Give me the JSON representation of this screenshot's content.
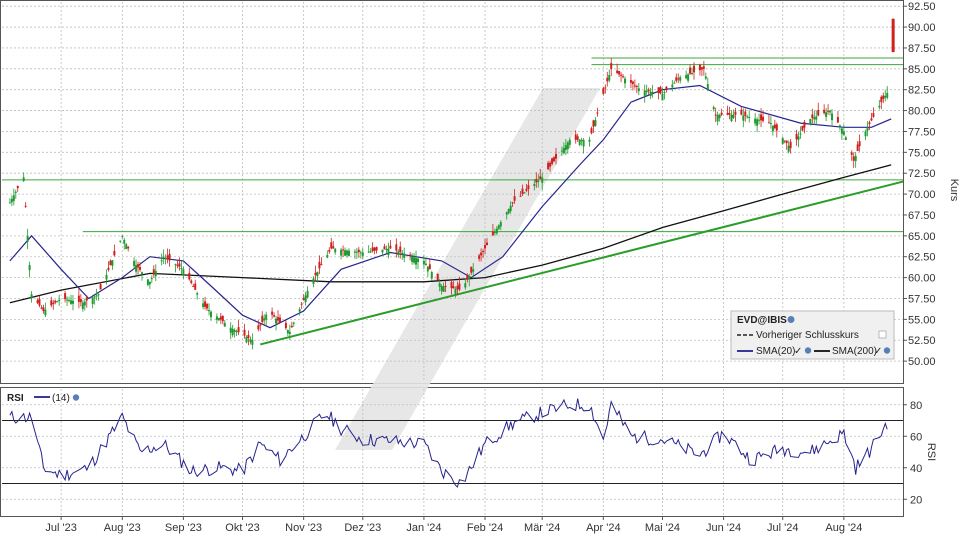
{
  "chart_data": [
    {
      "type": "candlestick",
      "legend": {
        "symbol": "EVD@IBIS",
        "prev_close_label": "Vorheriger Schlusskurs",
        "sma20_label": "SMA(20)",
        "sma200_label": "SMA(200)"
      },
      "ylabel": "Kurs",
      "ylim": [
        47.5,
        93.0
      ],
      "yticks": [
        "50.00",
        "52.50",
        "55.00",
        "57.50",
        "60.00",
        "62.50",
        "65.00",
        "67.50",
        "70.00",
        "72.50",
        "75.00",
        "77.50",
        "80.00",
        "82.50",
        "85.00",
        "87.50",
        "90.00",
        "92.50"
      ],
      "x_labels": [
        "Jul '23",
        "Aug '23",
        "Sep '23",
        "Okt '23",
        "Nov '23",
        "Dez '23",
        "Jan '24",
        "Feb '24",
        "Mär '24",
        "Apr '24",
        "Mai '24",
        "Jun '24",
        "Jul '24",
        "Aug '24"
      ],
      "price_path": [
        [
          "2023-06-05",
          69.0
        ],
        [
          "2023-06-12",
          72.0
        ],
        [
          "2023-06-16",
          58.0
        ],
        [
          "2023-06-22",
          56.0
        ],
        [
          "2023-07-01",
          57.5
        ],
        [
          "2023-07-12",
          57.0
        ],
        [
          "2023-07-20",
          58.0
        ],
        [
          "2023-08-01",
          65.0
        ],
        [
          "2023-08-08",
          61.5
        ],
        [
          "2023-08-15",
          59.5
        ],
        [
          "2023-08-22",
          62.5
        ],
        [
          "2023-09-01",
          61.0
        ],
        [
          "2023-09-12",
          56.5
        ],
        [
          "2023-09-25",
          54.0
        ],
        [
          "2023-10-06",
          52.5
        ],
        [
          "2023-10-14",
          56.0
        ],
        [
          "2023-10-25",
          53.5
        ],
        [
          "2023-11-05",
          59.5
        ],
        [
          "2023-11-15",
          63.5
        ],
        [
          "2023-12-01",
          63.0
        ],
        [
          "2023-12-15",
          63.5
        ],
        [
          "2024-01-01",
          62.0
        ],
        [
          "2024-01-10",
          59.0
        ],
        [
          "2024-01-20",
          58.5
        ],
        [
          "2024-02-01",
          63.5
        ],
        [
          "2024-02-15",
          69.0
        ],
        [
          "2024-03-01",
          72.0
        ],
        [
          "2024-03-15",
          76.5
        ],
        [
          "2024-03-25",
          76.5
        ],
        [
          "2024-04-01",
          82.0
        ],
        [
          "2024-04-05",
          85.0
        ],
        [
          "2024-04-20",
          82.5
        ],
        [
          "2024-05-01",
          82.0
        ],
        [
          "2024-05-10",
          84.0
        ],
        [
          "2024-05-22",
          85.0
        ],
        [
          "2024-05-28",
          79.5
        ],
        [
          "2024-06-10",
          79.5
        ],
        [
          "2024-06-25",
          78.5
        ],
        [
          "2024-07-05",
          75.5
        ],
        [
          "2024-07-15",
          79.0
        ],
        [
          "2024-07-25",
          80.0
        ],
        [
          "2024-08-01",
          77.5
        ],
        [
          "2024-08-06",
          74.0
        ],
        [
          "2024-08-12",
          77.5
        ],
        [
          "2024-08-20",
          81.0
        ],
        [
          "2024-08-24",
          82.5
        ]
      ],
      "last_candle": {
        "date": "2024-08-26",
        "open": 91.0,
        "close": 87.0
      },
      "sma20": [
        [
          "2023-06-05",
          62.0
        ],
        [
          "2023-06-16",
          65.0
        ],
        [
          "2023-07-01",
          61.0
        ],
        [
          "2023-07-15",
          57.5
        ],
        [
          "2023-08-01",
          60.0
        ],
        [
          "2023-08-15",
          62.5
        ],
        [
          "2023-09-01",
          62.0
        ],
        [
          "2023-09-15",
          59.0
        ],
        [
          "2023-10-01",
          55.5
        ],
        [
          "2023-10-15",
          54.0
        ],
        [
          "2023-11-01",
          56.0
        ],
        [
          "2023-11-20",
          61.0
        ],
        [
          "2023-12-15",
          63.0
        ],
        [
          "2024-01-10",
          62.0
        ],
        [
          "2024-01-25",
          60.0
        ],
        [
          "2024-02-10",
          62.5
        ],
        [
          "2024-03-01",
          68.5
        ],
        [
          "2024-03-20",
          73.5
        ],
        [
          "2024-04-01",
          76.5
        ],
        [
          "2024-04-15",
          81.0
        ],
        [
          "2024-05-01",
          82.5
        ],
        [
          "2024-05-20",
          83.0
        ],
        [
          "2024-06-10",
          80.5
        ],
        [
          "2024-07-10",
          78.5
        ],
        [
          "2024-08-01",
          78.0
        ],
        [
          "2024-08-15",
          78.0
        ],
        [
          "2024-08-25",
          79.0
        ]
      ],
      "sma200": [
        [
          "2023-06-05",
          57.0
        ],
        [
          "2023-07-01",
          58.5
        ],
        [
          "2023-08-15",
          60.5
        ],
        [
          "2023-10-01",
          60.0
        ],
        [
          "2023-11-15",
          59.5
        ],
        [
          "2024-01-01",
          59.5
        ],
        [
          "2024-02-01",
          60.0
        ],
        [
          "2024-03-01",
          61.5
        ],
        [
          "2024-04-01",
          63.5
        ],
        [
          "2024-05-01",
          66.0
        ],
        [
          "2024-06-01",
          68.0
        ],
        [
          "2024-07-01",
          70.0
        ],
        [
          "2024-08-01",
          72.0
        ],
        [
          "2024-08-25",
          73.5
        ]
      ],
      "support_lines": [
        {
          "from": [
            "2023-10-10",
            52.0
          ],
          "to": [
            "2024-08-31",
            71.5
          ]
        }
      ],
      "resistance_lines": [
        {
          "from": [
            "2023-06-01",
            71.7
          ],
          "to": [
            "2024-08-31",
            71.7
          ]
        },
        {
          "from": [
            "2023-07-12",
            65.5
          ],
          "to": [
            "2024-08-31",
            65.5
          ]
        },
        {
          "from": [
            "2024-03-26",
            86.3
          ],
          "to": [
            "2024-08-31",
            86.3
          ]
        },
        {
          "from": [
            "2024-03-26",
            85.5
          ],
          "to": [
            "2024-08-31",
            85.5
          ]
        }
      ]
    },
    {
      "type": "line",
      "legend_title": "RSI",
      "legend_period": "(14)",
      "ylabel": "RSI",
      "ylim": [
        10,
        90
      ],
      "yticks": [
        "20",
        "40",
        "60",
        "80"
      ],
      "reference_levels": [
        70,
        30
      ],
      "rsi": [
        [
          "2023-06-05",
          72
        ],
        [
          "2023-06-16",
          72
        ],
        [
          "2023-06-22",
          40
        ],
        [
          "2023-07-01",
          35
        ],
        [
          "2023-07-15",
          40
        ],
        [
          "2023-08-01",
          72
        ],
        [
          "2023-08-10",
          50
        ],
        [
          "2023-08-22",
          55
        ],
        [
          "2023-09-05",
          38
        ],
        [
          "2023-09-20",
          40
        ],
        [
          "2023-10-01",
          38
        ],
        [
          "2023-10-10",
          55
        ],
        [
          "2023-10-20",
          45
        ],
        [
          "2023-11-01",
          60
        ],
        [
          "2023-11-12",
          75
        ],
        [
          "2023-11-20",
          65
        ],
        [
          "2023-12-01",
          58
        ],
        [
          "2023-12-15",
          57
        ],
        [
          "2024-01-01",
          55
        ],
        [
          "2024-01-10",
          38
        ],
        [
          "2024-01-20",
          30
        ],
        [
          "2024-02-01",
          55
        ],
        [
          "2024-02-15",
          68
        ],
        [
          "2024-03-01",
          75
        ],
        [
          "2024-03-15",
          80
        ],
        [
          "2024-03-25",
          80
        ],
        [
          "2024-04-01",
          58
        ],
        [
          "2024-04-05",
          80
        ],
        [
          "2024-04-15",
          60
        ],
        [
          "2024-05-01",
          58
        ],
        [
          "2024-05-20",
          48
        ],
        [
          "2024-06-01",
          62
        ],
        [
          "2024-06-15",
          45
        ],
        [
          "2024-07-01",
          52
        ],
        [
          "2024-07-15",
          50
        ],
        [
          "2024-08-01",
          62
        ],
        [
          "2024-08-07",
          40
        ],
        [
          "2024-08-15",
          52
        ],
        [
          "2024-08-25",
          73
        ]
      ]
    }
  ]
}
